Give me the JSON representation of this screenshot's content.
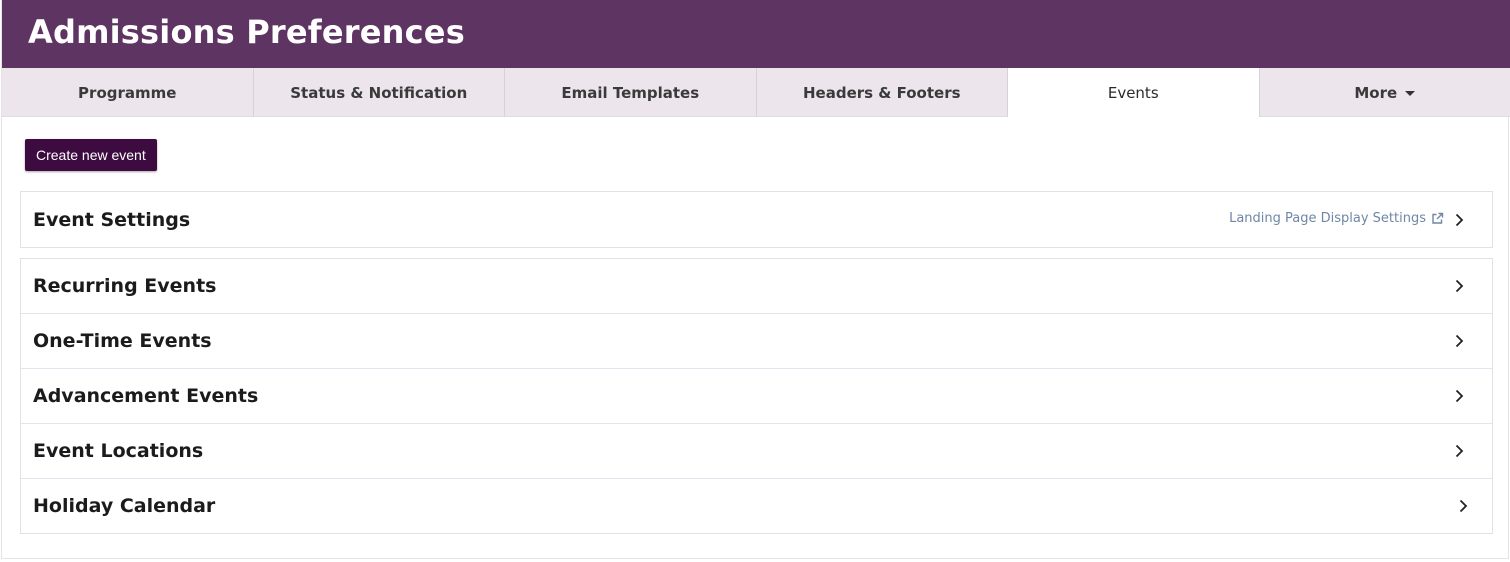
{
  "page": {
    "title": "Admissions Preferences"
  },
  "tabs": [
    {
      "label": "Programme"
    },
    {
      "label": "Status & Notification"
    },
    {
      "label": "Email Templates"
    },
    {
      "label": "Headers & Footers"
    },
    {
      "label": "Events",
      "active": true
    },
    {
      "label": "More",
      "has_dropdown": true
    }
  ],
  "actions": {
    "create_label": "Create new event"
  },
  "settings_card": {
    "title": "Event Settings",
    "link_label": "Landing Page Display Settings",
    "link_icon": "external-link-icon"
  },
  "sections": [
    {
      "title": "Recurring Events"
    },
    {
      "title": "One-Time Events"
    },
    {
      "title": "Advancement Events"
    },
    {
      "title": "Event Locations"
    },
    {
      "title": "Holiday Calendar"
    }
  ],
  "colors": {
    "header_bg": "#5e3462",
    "tab_bg": "#ece5ec",
    "button_bg": "#3d0b3f",
    "link": "#6f86a6"
  }
}
